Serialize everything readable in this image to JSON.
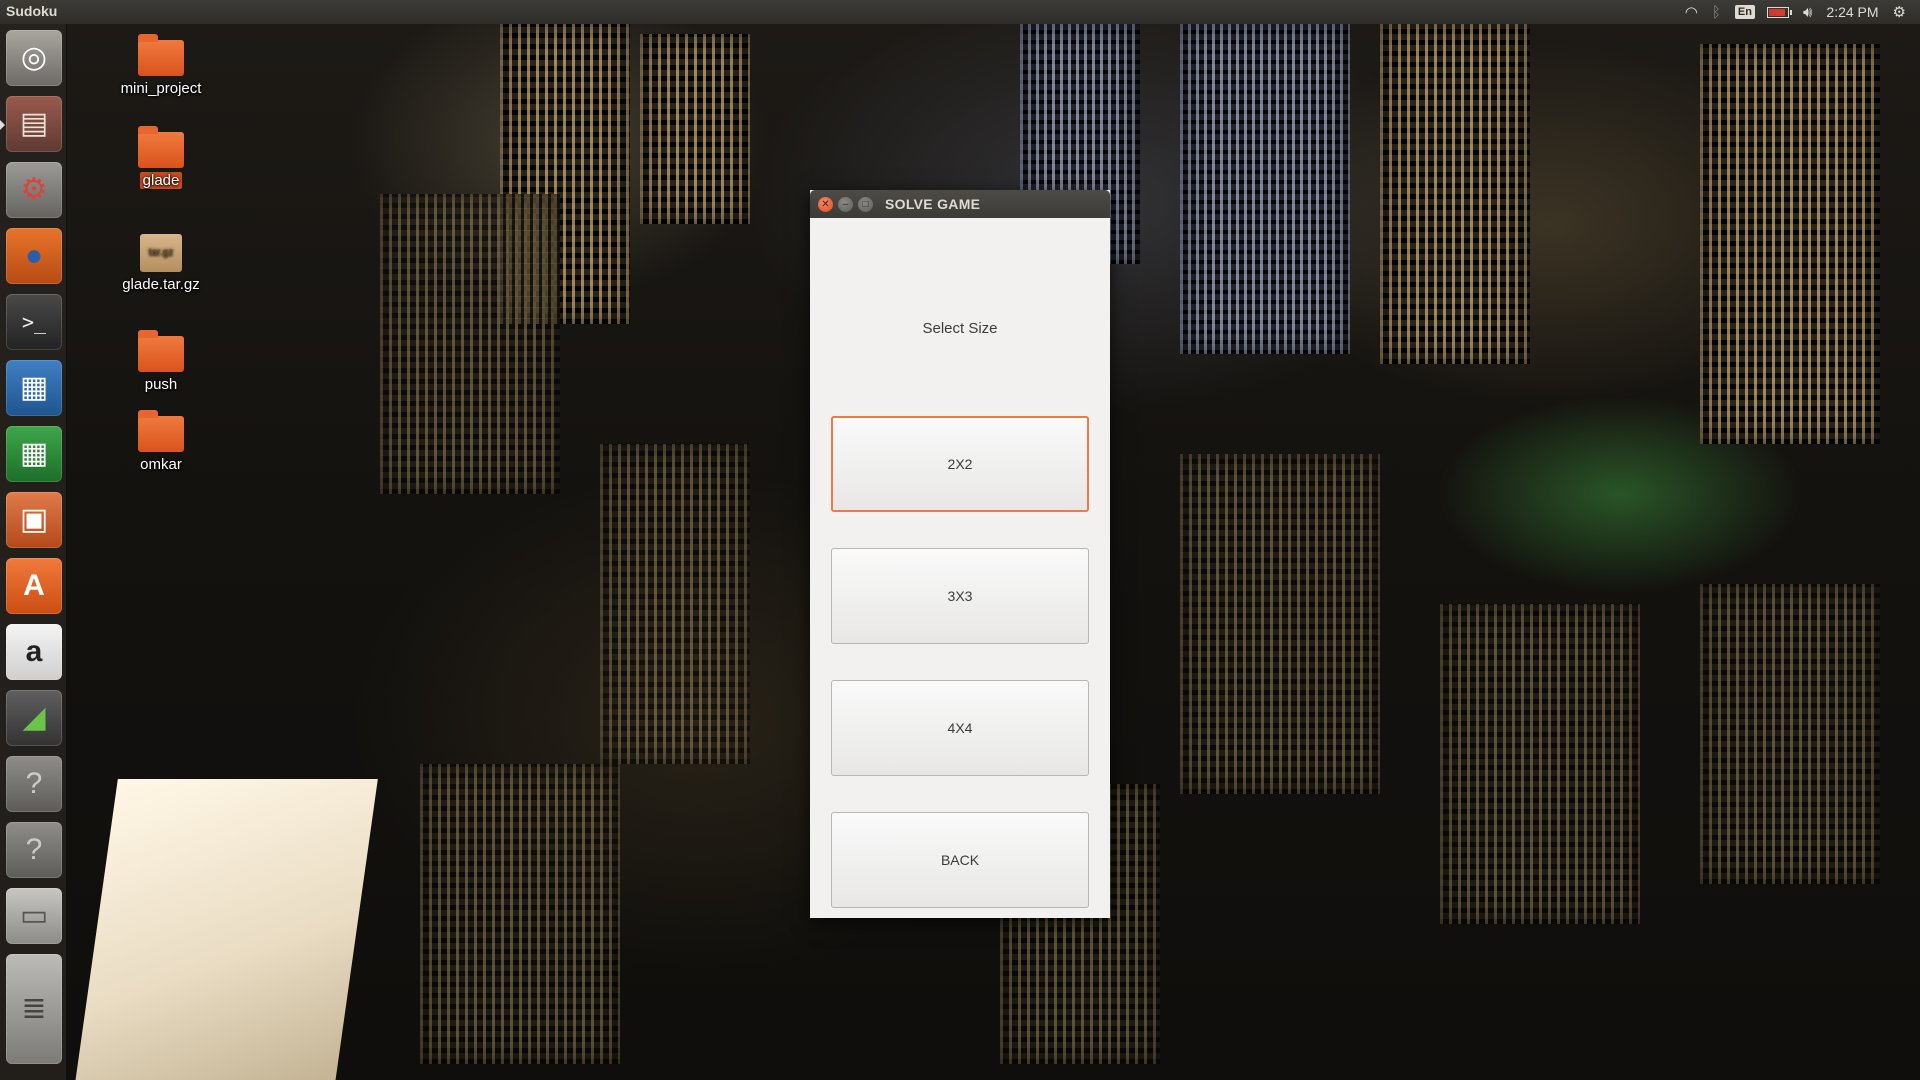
{
  "top_panel": {
    "app_title": "Sudoku",
    "language": "En",
    "clock": "2:24 PM",
    "icons": [
      "wifi-icon",
      "bluetooth-icon",
      "battery-icon",
      "volume-icon",
      "settings-gear-icon"
    ]
  },
  "launcher": {
    "items": [
      {
        "name": "ubuntu-dash-icon",
        "glyph": "◎"
      },
      {
        "name": "files-icon",
        "glyph": "▤"
      },
      {
        "name": "system-settings-icon",
        "glyph": "⚙"
      },
      {
        "name": "firefox-icon",
        "glyph": "●"
      },
      {
        "name": "terminal-icon",
        "glyph": ">_"
      },
      {
        "name": "writer-icon",
        "glyph": "▦"
      },
      {
        "name": "calc-icon",
        "glyph": "▦"
      },
      {
        "name": "impress-icon",
        "glyph": "▣"
      },
      {
        "name": "software-center-icon",
        "glyph": "A"
      },
      {
        "name": "amazon-icon",
        "glyph": "a"
      },
      {
        "name": "monitor-icon",
        "glyph": "◢"
      },
      {
        "name": "unknown-app-icon",
        "glyph": "?"
      },
      {
        "name": "unknown-app-icon",
        "glyph": "?"
      },
      {
        "name": "drive-icon",
        "glyph": "▭"
      },
      {
        "name": "drive-stack-icon",
        "glyph": "≣"
      }
    ]
  },
  "desktop": {
    "icons": [
      {
        "label": "mini_project",
        "type": "folder"
      },
      {
        "label": "glade",
        "type": "folder"
      },
      {
        "label": "glade.tar.gz",
        "type": "archive",
        "badge": "tar.gz"
      },
      {
        "label": "push",
        "type": "folder"
      },
      {
        "label": "omkar",
        "type": "folder"
      }
    ]
  },
  "window": {
    "title": "SOLVE GAME",
    "prompt": "Select Size",
    "buttons": [
      "2X2",
      "3X3",
      "4X4",
      "BACK"
    ]
  },
  "colors": {
    "accent": "#f07746",
    "panel": "#3c3b37",
    "window_bg": "#f2f1f0"
  }
}
